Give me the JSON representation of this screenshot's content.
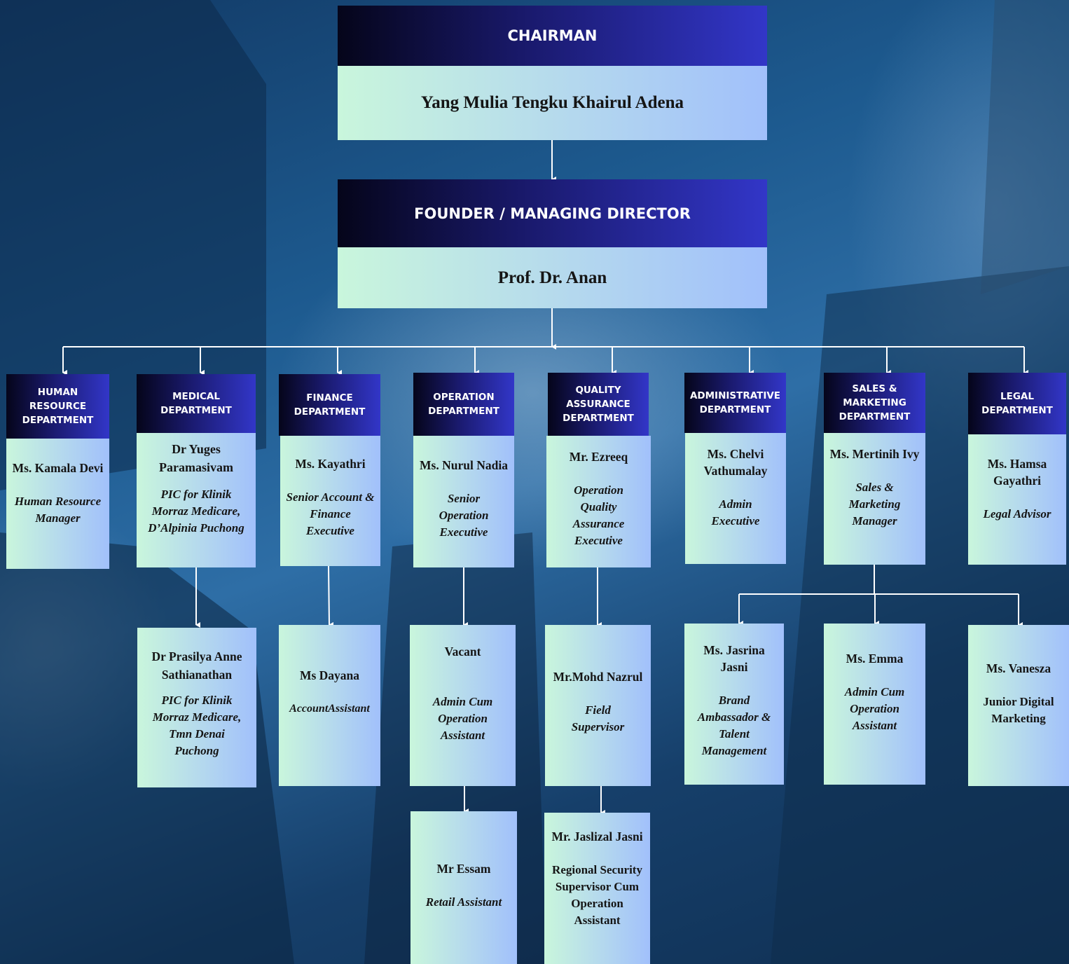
{
  "chairman": {
    "title": "CHAIRMAN",
    "name": "Yang Mulia Tengku Khairul Adena"
  },
  "director": {
    "title": "FOUNDER / MANAGING DIRECTOR",
    "name": "Prof. Dr. Anan"
  },
  "departments": [
    {
      "title": "HUMAN RESOURCE DEPARTMENT",
      "head": {
        "name": "Ms. Kamala Devi",
        "role": "Human Resource Manager"
      }
    },
    {
      "title": "MEDICAL DEPARTMENT",
      "head": {
        "name": "Dr Yuges Paramasivam",
        "role": "PIC for Klinik Morraz Medicare, D’Alpinia Puchong"
      },
      "staff": [
        {
          "name": "Dr Prasilya Anne Sathianathan",
          "role": "PIC for Klinik Morraz Medicare, Tmn Denai Puchong"
        }
      ]
    },
    {
      "title": "FINANCE DEPARTMENT",
      "head": {
        "name": "Ms. Kayathri",
        "role": "Senior Account & Finance Executive"
      },
      "staff": [
        {
          "name": "Ms Dayana",
          "role": "AccountAssistant"
        }
      ]
    },
    {
      "title": "OPERATION DEPARTMENT",
      "head": {
        "name": "Ms. Nurul Nadia",
        "role": "Senior Operation Executive"
      },
      "staff": [
        {
          "name": "Vacant",
          "role": "Admin Cum Operation Assistant"
        },
        {
          "name": "Mr Essam",
          "role": "Retail Assistant"
        }
      ]
    },
    {
      "title": "QUALITY ASSURANCE DEPARTMENT",
      "head": {
        "name": "Mr. Ezreeq",
        "role": "Operation Quality Assurance Executive"
      },
      "staff": [
        {
          "name": "Mr.Mohd Nazrul",
          "role": "Field Supervisor"
        },
        {
          "name": "Mr. Jaslizal Jasni",
          "role": "Regional Security Supervisor Cum Operation Assistant"
        }
      ]
    },
    {
      "title": "ADMINISTRATIVE DEPARTMENT",
      "head": {
        "name": "Ms. Chelvi Vathumalay",
        "role": "Admin Executive"
      }
    },
    {
      "title": "SALES & MARKETING DEPARTMENT",
      "head": {
        "name": "Ms. Mertinih Ivy",
        "role": "Sales & Marketing Manager"
      },
      "staff": [
        {
          "name": "Ms. Jasrina Jasni",
          "role": "Brand Ambassador & Talent Management"
        },
        {
          "name": "Ms. Emma",
          "role": "Admin Cum Operation Assistant"
        },
        {
          "name": "Ms. Vanesza",
          "role": "Junior Digital Marketing"
        }
      ]
    },
    {
      "title": "LEGAL DEPARTMENT",
      "head": {
        "name": "Ms. Hamsa Gayathri",
        "role": "Legal Advisor"
      }
    }
  ]
}
